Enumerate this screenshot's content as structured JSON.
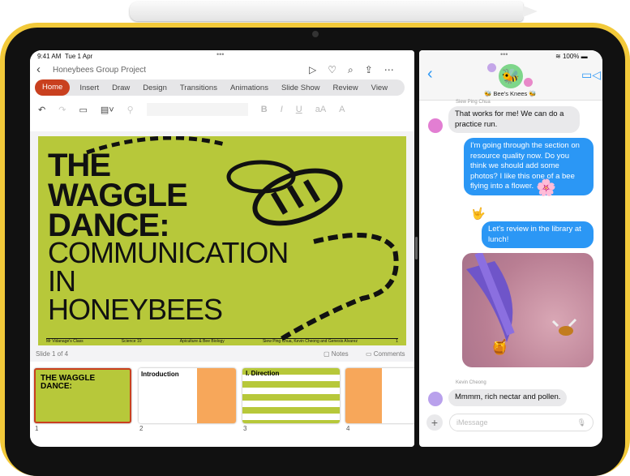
{
  "left_app": {
    "status": {
      "time": "9:41 AM",
      "date": "Tue 1 Apr"
    },
    "doc_title": "Honeybees Group Project",
    "tabs": [
      "Home",
      "Insert",
      "Draw",
      "Design",
      "Transitions",
      "Animations",
      "Slide Show",
      "Review",
      "View"
    ],
    "active_tab": "Home",
    "format_buttons": {
      "bold": "B",
      "italic": "I",
      "underline": "U",
      "size": "aA",
      "color": "A"
    },
    "slide": {
      "line1": "THE",
      "line2": "WAGGLE",
      "line3": "DANCE:",
      "line4": "COMMUNICATION",
      "line5": "IN",
      "line6": "HONEYBEES",
      "footer": [
        "Mr Vidanage's Class",
        "Science 10",
        "Apiculture & Bee Biology",
        "Siew Ping Chua, Kevin Cheong and Genesis Alvarez",
        "1"
      ]
    },
    "slide_counter": "Slide 1 of 4",
    "notes_label": "Notes",
    "comments_label": "Comments",
    "thumbnails": [
      {
        "num": "1",
        "title": "THE WAGGLE DANCE:"
      },
      {
        "num": "2",
        "title": "Introduction"
      },
      {
        "num": "3",
        "title": "I. Direction"
      },
      {
        "num": "4",
        "title": ""
      }
    ],
    "accent": "#c9401f"
  },
  "right_app": {
    "status": {
      "battery": "100%"
    },
    "group_name": "🐝 Bee's Knees 🐝",
    "messages": [
      {
        "sender": "Siew Ping Chua",
        "text": "That works for me! We can do a practice run.",
        "direction": "incoming"
      },
      {
        "text": "I'm going through the section on resource quality now. Do you think we should add some photos? I like this one of a bee flying into a flower.",
        "direction": "outgoing",
        "reaction": "🌸"
      },
      {
        "text": "Let's review in the library at lunch!",
        "direction": "outgoing",
        "reaction": "🤟"
      },
      {
        "type": "photo",
        "direction": "outgoing",
        "reaction": "🍯"
      },
      {
        "sender": "Kevin Cheong",
        "text": "Mmmm, rich nectar and pollen.",
        "direction": "incoming"
      }
    ],
    "input_placeholder": "iMessage",
    "accent": "#2b97f5"
  }
}
